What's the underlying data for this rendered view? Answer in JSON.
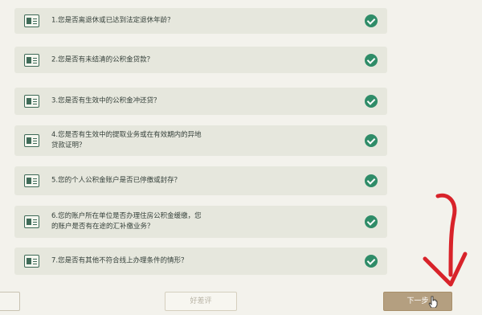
{
  "questions": [
    {
      "text": "1.您是否离退休或已达到法定退休年龄？"
    },
    {
      "text": "2.您是否有未结清的公积金贷款？"
    },
    {
      "text": "3.您是否有生效中的公积金冲还贷？"
    },
    {
      "text": "4.您是否有生效中的提取业务或在有效期内的异地\n贷款证明？"
    },
    {
      "text": "5.您的个人公积金账户是否已停缴或封存？"
    },
    {
      "text": "6.您的账户所在单位是否办理住房公积金缓缴，您\n的账户是否有在途的汇补缴业务？"
    },
    {
      "text": "7.您是否有其他不符合线上办理条件的情形？"
    }
  ],
  "footer": {
    "left_button_label": "",
    "review_label": "好差评",
    "next_label": "下一步"
  },
  "icons": {
    "question_icon": "document-icon",
    "status_icon": "check-circle-icon",
    "cursor": "hand-pointer-icon",
    "annotation": "red-arrow"
  },
  "colors": {
    "check": "#2f8c68",
    "row_bg": "#e6e7dd",
    "next_button": "#b49f80",
    "arrow": "#d8232a"
  }
}
